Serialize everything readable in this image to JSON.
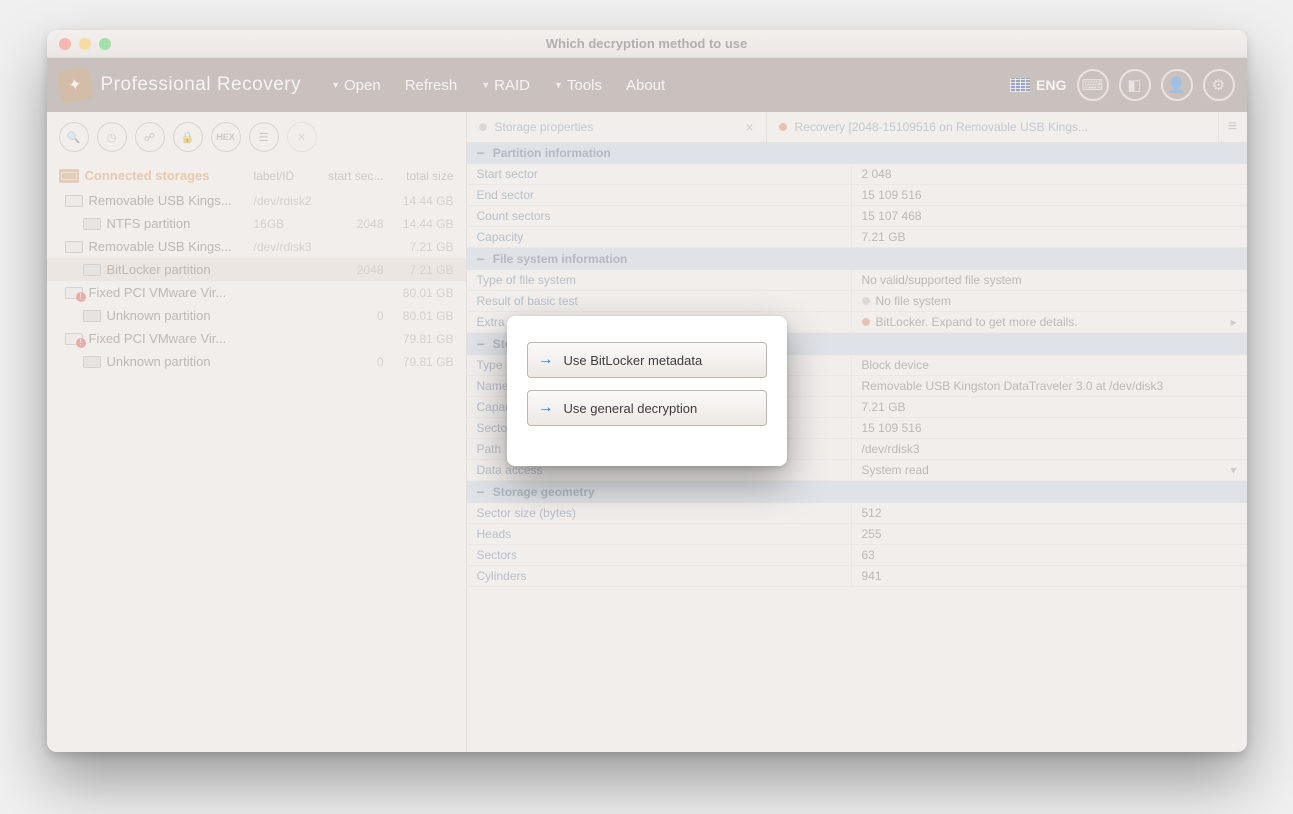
{
  "window": {
    "title": "Which decryption method to use"
  },
  "app": {
    "name": "Professional Recovery"
  },
  "menu": {
    "open": "Open",
    "refresh": "Refresh",
    "raid": "RAID",
    "tools": "Tools",
    "about": "About"
  },
  "lang": "ENG",
  "sidebar_header": {
    "title": "Connected storages",
    "col_label": "label/ID",
    "col_start": "start sec...",
    "col_total": "total size"
  },
  "storages": [
    {
      "type": "drive",
      "name": "Removable USB Kings...",
      "label": "/dev/rdisk2",
      "start": "",
      "size": "14.44 GB",
      "indent": 0,
      "warn": false
    },
    {
      "type": "part",
      "name": "NTFS partition",
      "label": "16GB",
      "start": "2048",
      "size": "14.44 GB",
      "indent": 1,
      "warn": false
    },
    {
      "type": "drive",
      "name": "Removable USB Kings...",
      "label": "/dev/rdisk3",
      "start": "",
      "size": "7.21 GB",
      "indent": 0,
      "warn": false
    },
    {
      "type": "part",
      "name": "BitLocker partition",
      "label": "",
      "start": "2048",
      "size": "7.21 GB",
      "indent": 1,
      "warn": false,
      "selected": true
    },
    {
      "type": "drive",
      "name": "Fixed PCI VMware Vir...",
      "label": "",
      "start": "",
      "size": "80.01 GB",
      "indent": 0,
      "warn": true
    },
    {
      "type": "part",
      "name": "Unknown partition",
      "label": "",
      "start": "0",
      "size": "80.01 GB",
      "indent": 1,
      "warn": false
    },
    {
      "type": "drive",
      "name": "Fixed PCI VMware Vir...",
      "label": "",
      "start": "",
      "size": "79.81 GB",
      "indent": 0,
      "warn": true
    },
    {
      "type": "part",
      "name": "Unknown partition",
      "label": "",
      "start": "0",
      "size": "79.81 GB",
      "indent": 1,
      "warn": false
    }
  ],
  "tabs": {
    "props": "Storage properties",
    "recovery": "Recovery [2048-15109516 on Removable USB Kings..."
  },
  "sections": {
    "partition": "Partition information",
    "filesystem": "File system information",
    "storage": "Storage information",
    "geometry": "Storage geometry"
  },
  "partition": {
    "start_k": "Start sector",
    "start_v": "2 048",
    "end_k": "End sector",
    "end_v": "15 109 516",
    "count_k": "Count sectors",
    "count_v": "15 107 468",
    "cap_k": "Capacity",
    "cap_v": "7.21 GB"
  },
  "fs": {
    "type_k": "Type of file system",
    "type_v": "No valid/supported file system",
    "test_k": "Result of basic test",
    "test_v": "No file system",
    "extra_k": "Extra results",
    "extra_v": "BitLocker. Expand to get more details."
  },
  "storage": {
    "type_k": "Type",
    "type_v": "Block device",
    "name_k": "Name",
    "name_v": "Removable USB Kingston DataTraveler 3.0 at /dev/disk3",
    "cap_k": "Capacity",
    "cap_v": "7.21 GB",
    "sec_k": "Sectors",
    "sec_v": "15 109 516",
    "path_k": "Path",
    "path_v": "/dev/rdisk3",
    "acc_k": "Data access",
    "acc_v": "System read"
  },
  "geom": {
    "ss_k": "Sector size (bytes)",
    "ss_v": "512",
    "h_k": "Heads",
    "h_v": "255",
    "s_k": "Sectors",
    "s_v": "63",
    "c_k": "Cylinders",
    "c_v": "941"
  },
  "modal": {
    "opt1": "Use BitLocker metadata",
    "opt2": "Use general decryption"
  }
}
